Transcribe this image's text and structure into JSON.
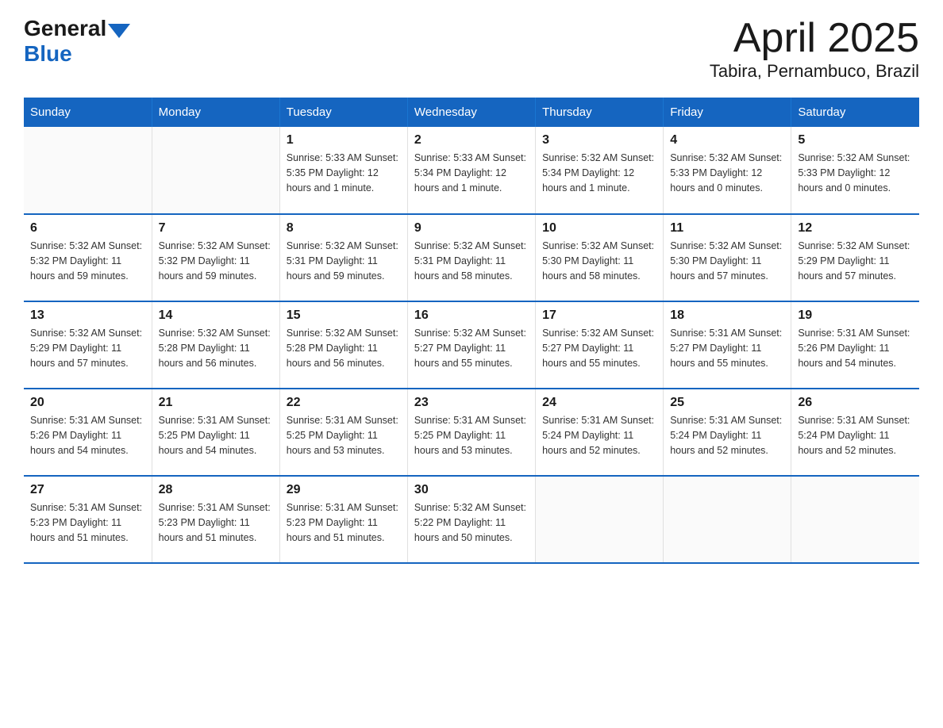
{
  "logo": {
    "general": "General",
    "blue": "Blue"
  },
  "title": "April 2025",
  "subtitle": "Tabira, Pernambuco, Brazil",
  "days_of_week": [
    "Sunday",
    "Monday",
    "Tuesday",
    "Wednesday",
    "Thursday",
    "Friday",
    "Saturday"
  ],
  "weeks": [
    [
      {
        "day": "",
        "info": ""
      },
      {
        "day": "",
        "info": ""
      },
      {
        "day": "1",
        "info": "Sunrise: 5:33 AM\nSunset: 5:35 PM\nDaylight: 12 hours\nand 1 minute."
      },
      {
        "day": "2",
        "info": "Sunrise: 5:33 AM\nSunset: 5:34 PM\nDaylight: 12 hours\nand 1 minute."
      },
      {
        "day": "3",
        "info": "Sunrise: 5:32 AM\nSunset: 5:34 PM\nDaylight: 12 hours\nand 1 minute."
      },
      {
        "day": "4",
        "info": "Sunrise: 5:32 AM\nSunset: 5:33 PM\nDaylight: 12 hours\nand 0 minutes."
      },
      {
        "day": "5",
        "info": "Sunrise: 5:32 AM\nSunset: 5:33 PM\nDaylight: 12 hours\nand 0 minutes."
      }
    ],
    [
      {
        "day": "6",
        "info": "Sunrise: 5:32 AM\nSunset: 5:32 PM\nDaylight: 11 hours\nand 59 minutes."
      },
      {
        "day": "7",
        "info": "Sunrise: 5:32 AM\nSunset: 5:32 PM\nDaylight: 11 hours\nand 59 minutes."
      },
      {
        "day": "8",
        "info": "Sunrise: 5:32 AM\nSunset: 5:31 PM\nDaylight: 11 hours\nand 59 minutes."
      },
      {
        "day": "9",
        "info": "Sunrise: 5:32 AM\nSunset: 5:31 PM\nDaylight: 11 hours\nand 58 minutes."
      },
      {
        "day": "10",
        "info": "Sunrise: 5:32 AM\nSunset: 5:30 PM\nDaylight: 11 hours\nand 58 minutes."
      },
      {
        "day": "11",
        "info": "Sunrise: 5:32 AM\nSunset: 5:30 PM\nDaylight: 11 hours\nand 57 minutes."
      },
      {
        "day": "12",
        "info": "Sunrise: 5:32 AM\nSunset: 5:29 PM\nDaylight: 11 hours\nand 57 minutes."
      }
    ],
    [
      {
        "day": "13",
        "info": "Sunrise: 5:32 AM\nSunset: 5:29 PM\nDaylight: 11 hours\nand 57 minutes."
      },
      {
        "day": "14",
        "info": "Sunrise: 5:32 AM\nSunset: 5:28 PM\nDaylight: 11 hours\nand 56 minutes."
      },
      {
        "day": "15",
        "info": "Sunrise: 5:32 AM\nSunset: 5:28 PM\nDaylight: 11 hours\nand 56 minutes."
      },
      {
        "day": "16",
        "info": "Sunrise: 5:32 AM\nSunset: 5:27 PM\nDaylight: 11 hours\nand 55 minutes."
      },
      {
        "day": "17",
        "info": "Sunrise: 5:32 AM\nSunset: 5:27 PM\nDaylight: 11 hours\nand 55 minutes."
      },
      {
        "day": "18",
        "info": "Sunrise: 5:31 AM\nSunset: 5:27 PM\nDaylight: 11 hours\nand 55 minutes."
      },
      {
        "day": "19",
        "info": "Sunrise: 5:31 AM\nSunset: 5:26 PM\nDaylight: 11 hours\nand 54 minutes."
      }
    ],
    [
      {
        "day": "20",
        "info": "Sunrise: 5:31 AM\nSunset: 5:26 PM\nDaylight: 11 hours\nand 54 minutes."
      },
      {
        "day": "21",
        "info": "Sunrise: 5:31 AM\nSunset: 5:25 PM\nDaylight: 11 hours\nand 54 minutes."
      },
      {
        "day": "22",
        "info": "Sunrise: 5:31 AM\nSunset: 5:25 PM\nDaylight: 11 hours\nand 53 minutes."
      },
      {
        "day": "23",
        "info": "Sunrise: 5:31 AM\nSunset: 5:25 PM\nDaylight: 11 hours\nand 53 minutes."
      },
      {
        "day": "24",
        "info": "Sunrise: 5:31 AM\nSunset: 5:24 PM\nDaylight: 11 hours\nand 52 minutes."
      },
      {
        "day": "25",
        "info": "Sunrise: 5:31 AM\nSunset: 5:24 PM\nDaylight: 11 hours\nand 52 minutes."
      },
      {
        "day": "26",
        "info": "Sunrise: 5:31 AM\nSunset: 5:24 PM\nDaylight: 11 hours\nand 52 minutes."
      }
    ],
    [
      {
        "day": "27",
        "info": "Sunrise: 5:31 AM\nSunset: 5:23 PM\nDaylight: 11 hours\nand 51 minutes."
      },
      {
        "day": "28",
        "info": "Sunrise: 5:31 AM\nSunset: 5:23 PM\nDaylight: 11 hours\nand 51 minutes."
      },
      {
        "day": "29",
        "info": "Sunrise: 5:31 AM\nSunset: 5:23 PM\nDaylight: 11 hours\nand 51 minutes."
      },
      {
        "day": "30",
        "info": "Sunrise: 5:32 AM\nSunset: 5:22 PM\nDaylight: 11 hours\nand 50 minutes."
      },
      {
        "day": "",
        "info": ""
      },
      {
        "day": "",
        "info": ""
      },
      {
        "day": "",
        "info": ""
      }
    ]
  ]
}
